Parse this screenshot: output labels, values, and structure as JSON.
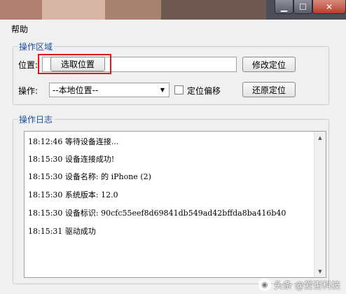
{
  "window": {
    "minimize_glyph": "▁",
    "maximize_glyph": "☐",
    "close_glyph": "✕"
  },
  "menu": {
    "help": "帮助"
  },
  "operation_area": {
    "title": "操作区域",
    "position_label": "位置:",
    "select_position_button": "选取位置",
    "modify_location_button": "修改定位",
    "operation_label": "操作:",
    "operation_select": {
      "selected": "--本地位置--"
    },
    "offset_checkbox": {
      "label": "定位偏移",
      "checked": false
    },
    "restore_location_button": "还原定位"
  },
  "log": {
    "title": "操作日志",
    "lines": [
      "18:12:46 等待设备连接...",
      "18:15:30 设备连接成功!",
      "18:15:30 设备名称:      的 iPhone (2)",
      "18:15:30 系统版本: 12.0",
      "18:15:30 设备标识: 90cfc55eef8d69841db549ad42bffda8ba416b40",
      "18:15:31 驱动成功"
    ]
  },
  "watermark": {
    "text": "头条 @爱否科技"
  },
  "colors": {
    "accent": "#1e4fa4",
    "highlight": "#e0181c"
  },
  "icons": {
    "dropdown": "chevron-down-icon",
    "scroll_up": "arrow-up-icon",
    "scroll_down": "arrow-down-icon"
  }
}
